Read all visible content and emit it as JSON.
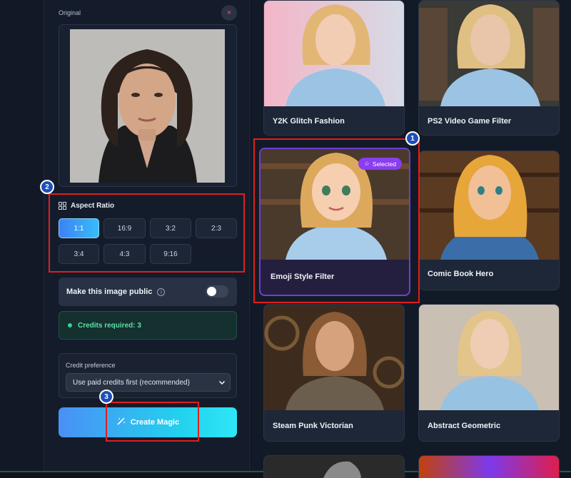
{
  "original_panel": {
    "label": "Original",
    "close_symbol": "×"
  },
  "aspect_ratio": {
    "title": "Aspect Ratio",
    "icon": "grid-icon",
    "options": [
      "1:1",
      "16:9",
      "3:2",
      "2:3",
      "3:4",
      "4:3",
      "9:16"
    ],
    "selected": "1:1"
  },
  "public_toggle": {
    "label": "Make this image public",
    "info_symbol": "i",
    "enabled": false
  },
  "credits": {
    "text": "Credits required: 3"
  },
  "credit_preference": {
    "label": "Credit preference",
    "selected": "Use paid credits first (recommended)"
  },
  "create_button": {
    "label": "Create Magic",
    "icon": "magic-wand-icon"
  },
  "styles": [
    {
      "title": "Y2K Glitch Fashion"
    },
    {
      "title": "PS2 Video Game Filter"
    },
    {
      "title": "Emoji Style Filter",
      "selected": true,
      "badge": "Selected"
    },
    {
      "title": "Comic Book Hero"
    },
    {
      "title": "Steam Punk Victorian"
    },
    {
      "title": "Abstract Geometric"
    }
  ],
  "annotations": [
    "1",
    "2",
    "3"
  ],
  "colors": {
    "background": "#131a27",
    "accent_purple": "#8b3df0",
    "highlight_red": "#e11d1d",
    "credits_green": "#5ee0a8",
    "gradient_start": "#4a90f5",
    "gradient_end": "#22d3ee"
  }
}
